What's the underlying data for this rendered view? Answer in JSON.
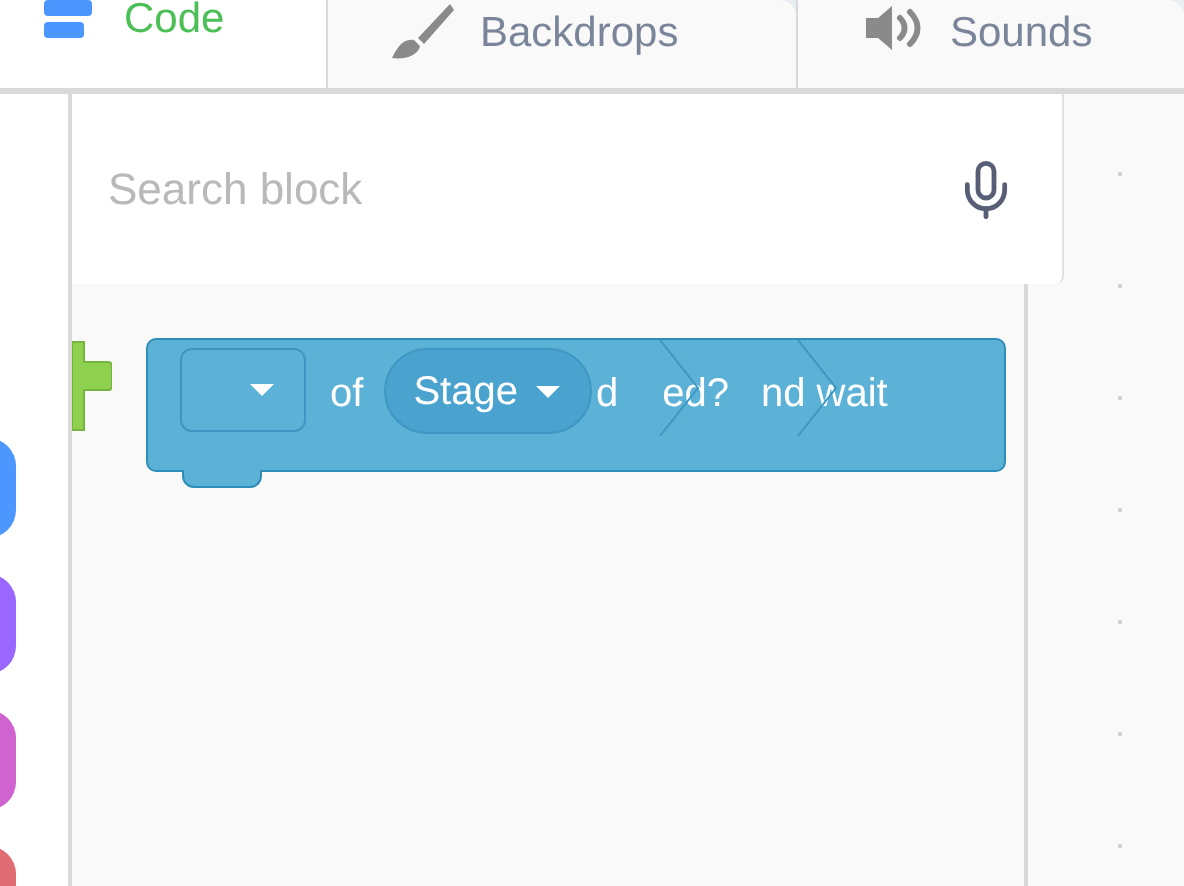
{
  "tabs": [
    {
      "label": "Code",
      "kind": "code",
      "selected": true
    },
    {
      "label": "Backdrops",
      "kind": "backdrops",
      "selected": false
    },
    {
      "label": "Sounds",
      "kind": "sounds",
      "selected": false
    }
  ],
  "search": {
    "placeholder": "Search block"
  },
  "categories": [
    {
      "color": "#4c97ff"
    },
    {
      "color": "#9966ff"
    },
    {
      "color": "#cf63cf"
    },
    {
      "color": "#e06b73"
    }
  ],
  "block": {
    "of_label": "of",
    "target": "Stage",
    "fragments": [
      "d",
      "ed?",
      "nd wait"
    ]
  }
}
